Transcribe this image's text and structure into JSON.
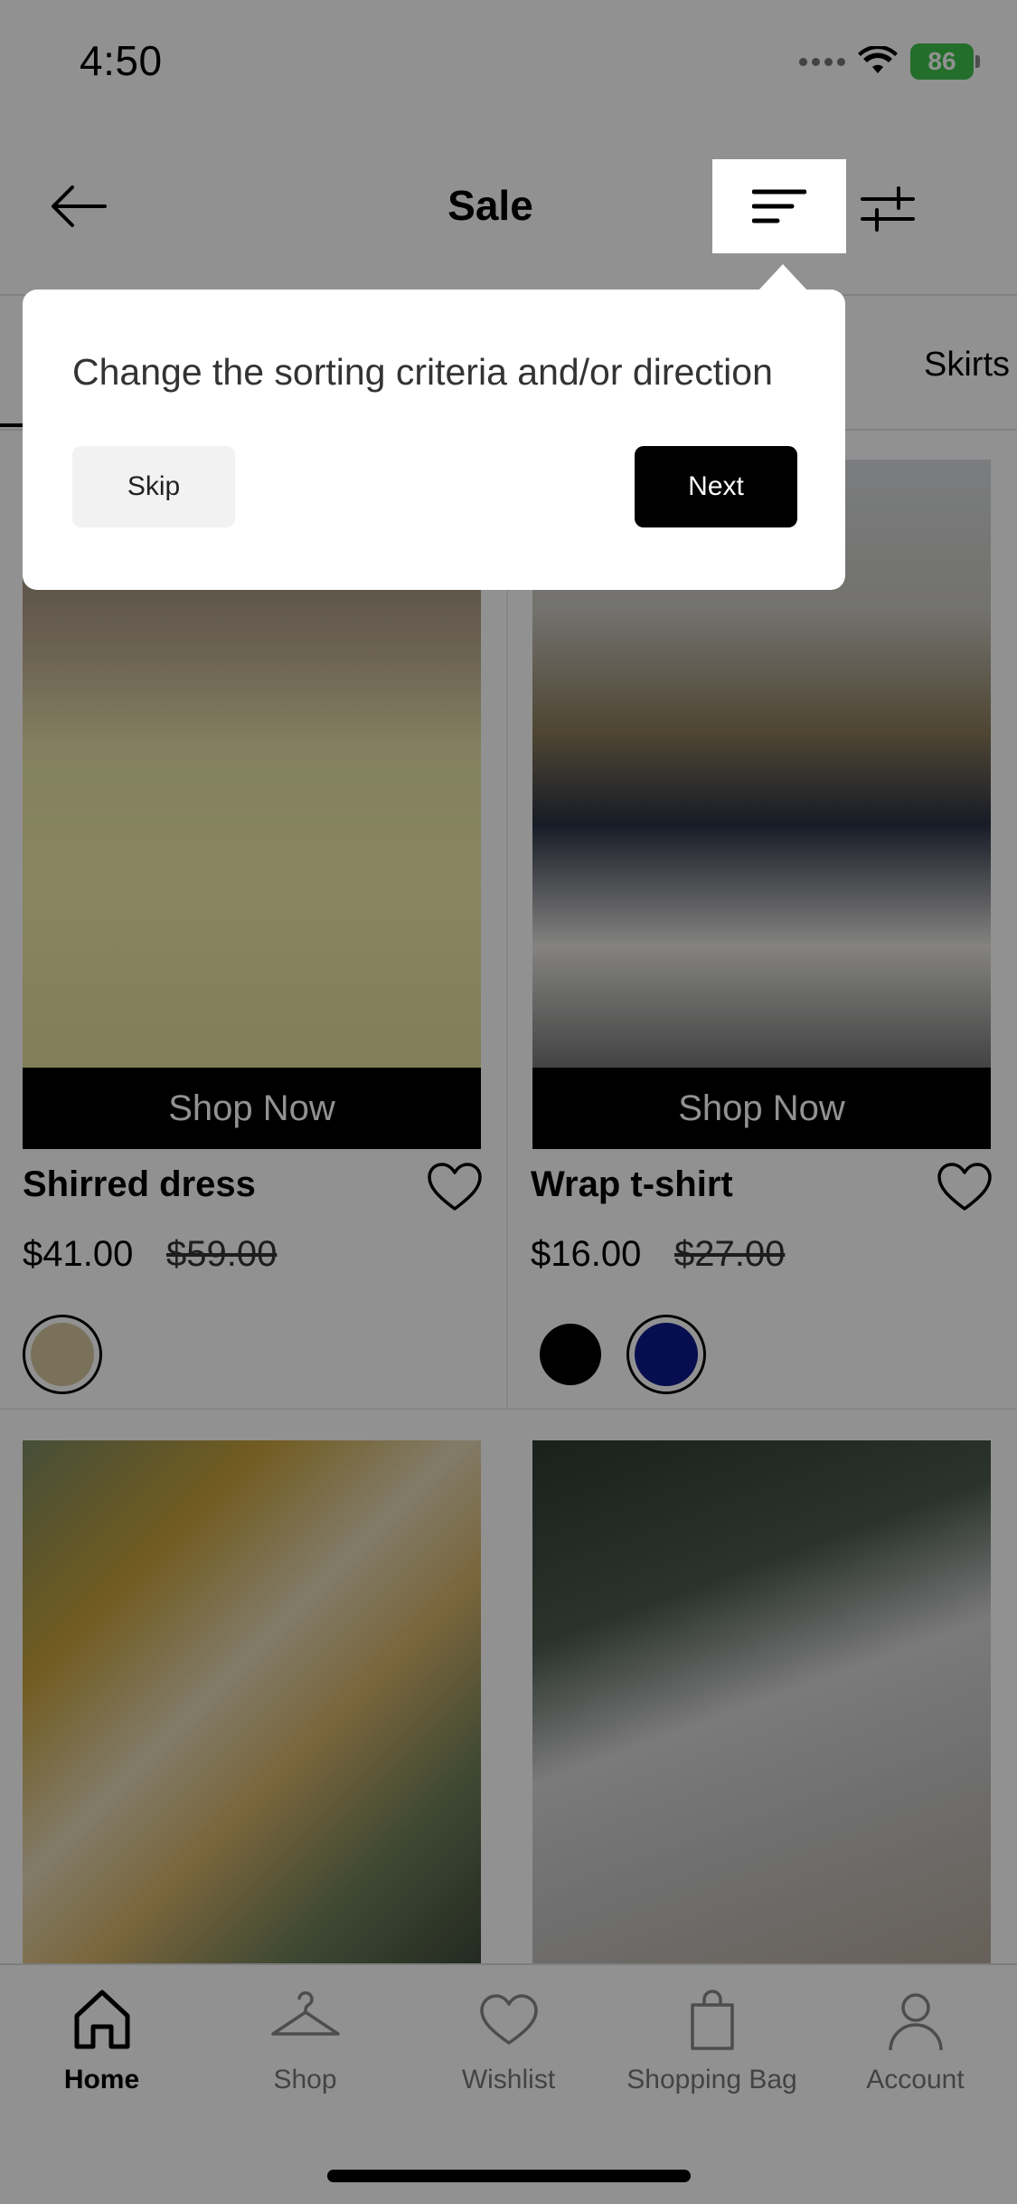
{
  "status_bar": {
    "time": "4:50",
    "battery": "86"
  },
  "header": {
    "title": "Sale"
  },
  "tabs": [
    {
      "label": "Skirts"
    }
  ],
  "tooltip": {
    "text": "Change the sorting criteria and/or direction",
    "skip_label": "Skip",
    "next_label": "Next"
  },
  "products": [
    {
      "name": "Shirred dress",
      "price": "$41.00",
      "old_price": "$59.00",
      "cta": "Shop Now",
      "swatches": [
        "#d6c7a0"
      ]
    },
    {
      "name": "Wrap t-shirt",
      "price": "$16.00",
      "old_price": "$27.00",
      "cta": "Shop Now",
      "swatches": [
        "#000000",
        "#0c1a8c"
      ]
    },
    {
      "name": "",
      "price": "",
      "old_price": "",
      "cta": "",
      "swatches": []
    },
    {
      "name": "",
      "price": "",
      "old_price": "",
      "cta": "",
      "swatches": []
    }
  ],
  "bottom_nav": [
    {
      "label": "Home",
      "icon": "home-icon",
      "active": true
    },
    {
      "label": "Shop",
      "icon": "hanger-icon",
      "active": false
    },
    {
      "label": "Wishlist",
      "icon": "heart-icon",
      "active": false
    },
    {
      "label": "Shopping Bag",
      "icon": "bag-icon",
      "active": false
    },
    {
      "label": "Account",
      "icon": "account-icon",
      "active": false
    }
  ],
  "colors": {
    "overlay": "#000000",
    "battery": "#3ec14a"
  }
}
